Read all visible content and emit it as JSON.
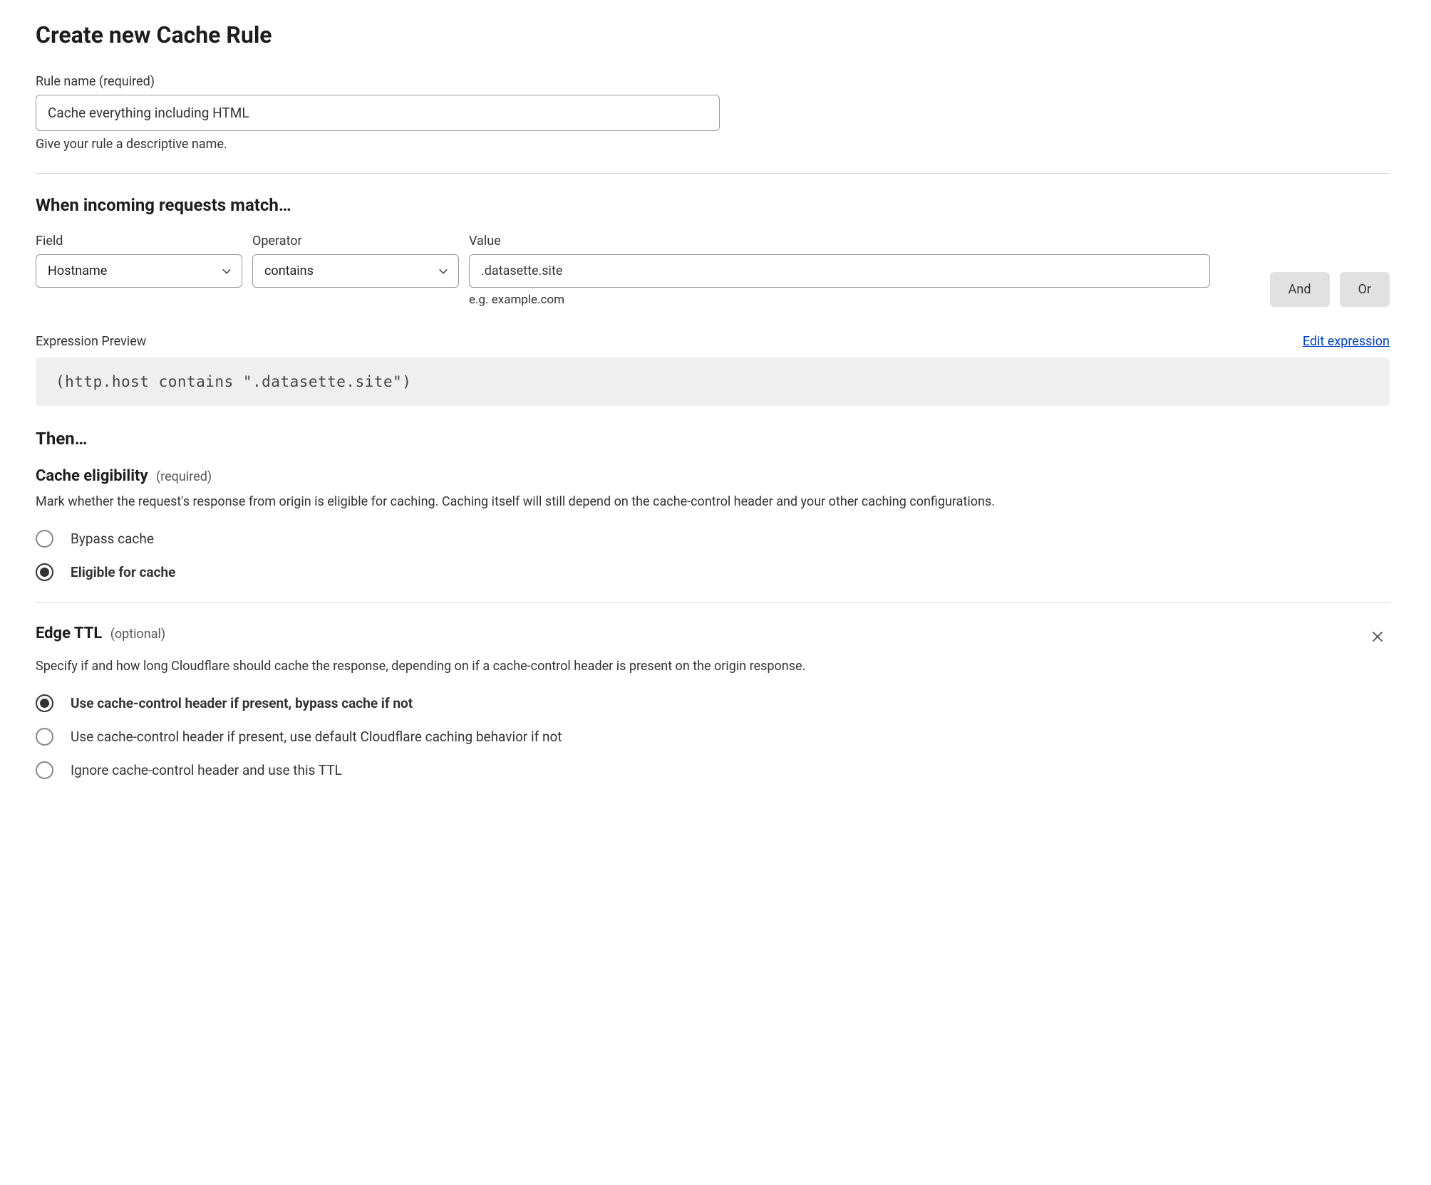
{
  "header": {
    "title": "Create new Cache Rule"
  },
  "rule_name": {
    "label": "Rule name (required)",
    "value": "Cache everything including HTML",
    "helper": "Give your rule a descriptive name."
  },
  "match": {
    "heading": "When incoming requests match…",
    "field_label": "Field",
    "operator_label": "Operator",
    "value_label": "Value",
    "field_selected": "Hostname",
    "operator_selected": "contains",
    "value": ".datasette.site",
    "value_hint": "e.g. example.com",
    "and_btn": "And",
    "or_btn": "Or"
  },
  "preview": {
    "label": "Expression Preview",
    "edit_link": "Edit expression",
    "expression": "(http.host contains \".datasette.site\")"
  },
  "then_heading": "Then…",
  "cache_eligibility": {
    "title": "Cache eligibility",
    "tag": "(required)",
    "desc": "Mark whether the request's response from origin is eligible for caching. Caching itself will still depend on the cache-control header and your other caching configurations.",
    "options": [
      {
        "label": "Bypass cache",
        "selected": false
      },
      {
        "label": "Eligible for cache",
        "selected": true
      }
    ]
  },
  "edge_ttl": {
    "title": "Edge TTL",
    "tag": "(optional)",
    "desc": "Specify if and how long Cloudflare should cache the response, depending on if a cache-control header is present on the origin response.",
    "options": [
      {
        "label": "Use cache-control header if present, bypass cache if not",
        "selected": true
      },
      {
        "label": "Use cache-control header if present, use default Cloudflare caching behavior if not",
        "selected": false
      },
      {
        "label": "Ignore cache-control header and use this TTL",
        "selected": false
      }
    ]
  }
}
